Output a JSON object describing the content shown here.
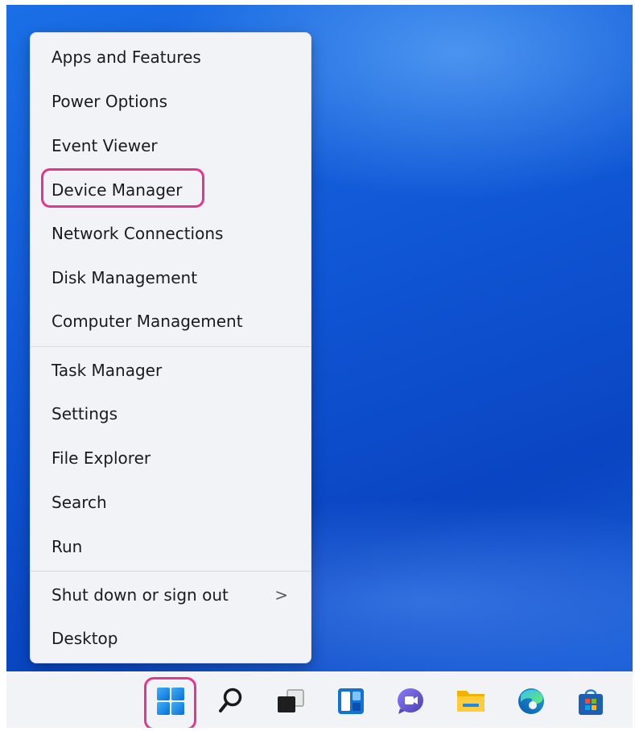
{
  "menu": {
    "items": [
      {
        "label": "Apps and Features"
      },
      {
        "label": "Power Options"
      },
      {
        "label": "Event Viewer"
      },
      {
        "label": "Device Manager"
      },
      {
        "label": "Network Connections"
      },
      {
        "label": "Disk Management"
      },
      {
        "label": "Computer Management"
      },
      {
        "label": "Task Manager"
      },
      {
        "label": "Settings"
      },
      {
        "label": "File Explorer"
      },
      {
        "label": "Search"
      },
      {
        "label": "Run"
      },
      {
        "label": "Shut down or sign out",
        "submenu_icon": "chevron-right-icon",
        "submenu_glyph": ">"
      },
      {
        "label": "Desktop"
      }
    ],
    "highlighted_item": "Device Manager"
  },
  "taskbar": {
    "icons": [
      "start-icon",
      "search-icon",
      "task-view-icon",
      "widgets-icon",
      "teams-chat-icon",
      "file-explorer-icon",
      "edge-icon",
      "store-icon"
    ],
    "highlighted_icon": "start-icon"
  },
  "colors": {
    "highlight": "#e0388c",
    "menu_background": "#f1f3f7",
    "taskbar_background": "#f2f3f6",
    "desktop_blue": "#0f55d4"
  }
}
